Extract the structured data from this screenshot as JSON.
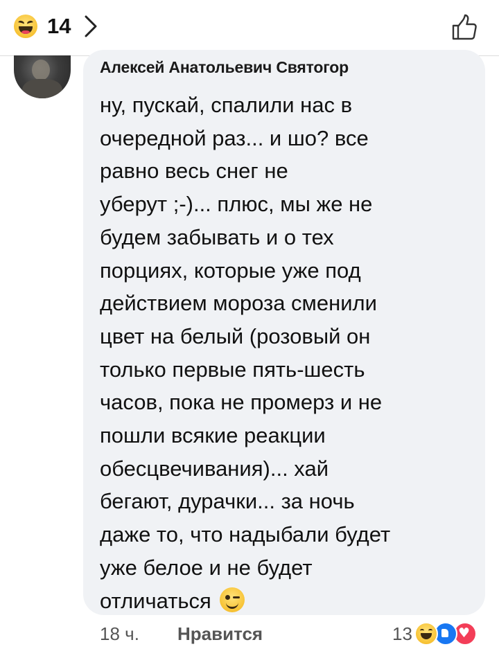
{
  "top_bar": {
    "reaction_icon": "haha-emoji-icon",
    "reaction_count": "14",
    "chevron_icon": "chevron-right-icon",
    "like_icon": "thumbs-up-outline-icon"
  },
  "comment": {
    "author": "Алексей Анатольевич Святогор",
    "text": "ну, пускай, спалили нас в\nочередной раз... и шо? все\nравно весь снег не\nуберут ;-)... плюс, мы же не\nбудем забывать и о тех\nпорциях, которые уже под\nдействием мороза сменили\nцвет на белый (розовый он\nтолько первые пять-шесть\nчасов, пока не промерз и не\nпошли всякие реакции\nобесцвечивания)... хай\nбегают, дурачки... за ночь\nдаже то, что надыбали будет\nуже белое и не будет\nотличаться",
    "trailing_emoji": "wink-emoji-icon",
    "time": "18 ч.",
    "like_label": "Нравится",
    "reaction_count": "13",
    "reactions": [
      "haha-emoji-icon",
      "like-reaction-icon",
      "love-reaction-icon"
    ]
  },
  "colors": {
    "bubble_bg": "#f0f2f5",
    "like_blue": "#1877f2",
    "love_red": "#f33e58",
    "emoji_yellow": "#f7c234"
  }
}
